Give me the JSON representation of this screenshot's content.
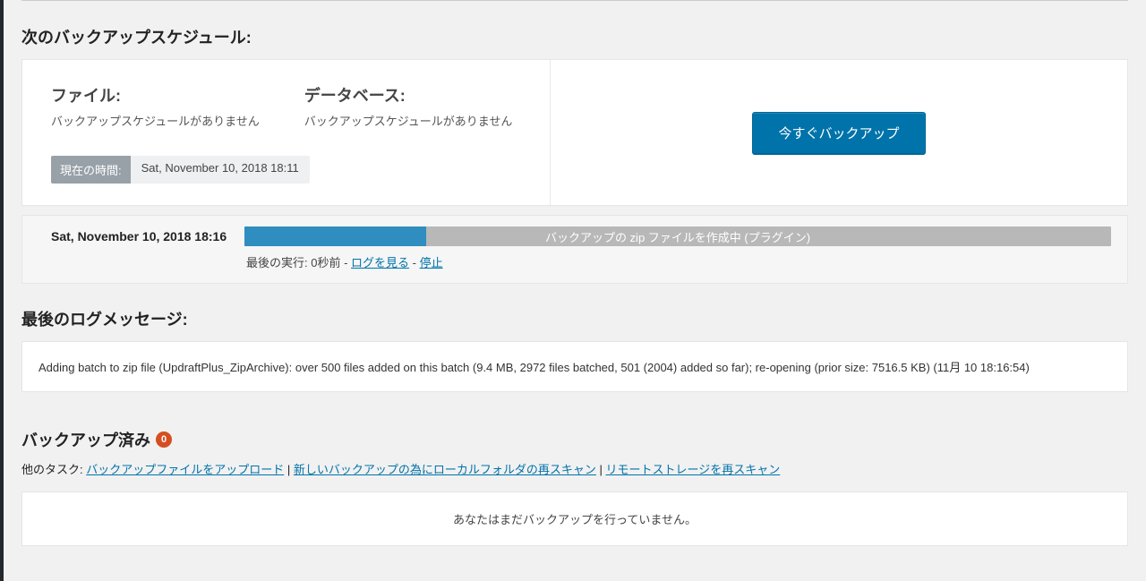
{
  "sections": {
    "schedule": {
      "title": "次のバックアップスケジュール:",
      "files": {
        "heading": "ファイル:",
        "status": "バックアップスケジュールがありません"
      },
      "database": {
        "heading": "データベース:",
        "status": "バックアップスケジュールがありません"
      },
      "current_time": {
        "label": "現在の時間:",
        "value": "Sat, November 10, 2018 18:11"
      },
      "backup_now_button": "今すぐバックアップ"
    },
    "progress": {
      "timestamp": "Sat, November 10, 2018 18:16",
      "bar": {
        "label": "バックアップの zip ファイルを作成中 (プラグイン)",
        "percent": 21
      },
      "substatus": {
        "prefix": "最後の実行: 0秒前 - ",
        "link_view_log": "ログを見る",
        "sep": " - ",
        "link_stop": "停止"
      }
    },
    "last_log": {
      "title": "最後のログメッセージ:",
      "message": "Adding batch to zip file (UpdraftPlus_ZipArchive): over 500 files added on this batch (9.4 MB, 2972 files batched, 501 (2004) added so far); re-opening (prior size: 7516.5 KB) (11月 10 18:16:54)"
    },
    "backups": {
      "title": "バックアップ済み",
      "count": "0",
      "other_tasks": {
        "label": "他のタスク: ",
        "link_upload": "バックアップファイルをアップロード",
        "link_rescan_local": "新しいバックアップの為にローカルフォルダの再スキャン",
        "link_rescan_remote": "リモートストレージを再スキャン"
      },
      "empty": "あなたはまだバックアップを行っていません。"
    }
  }
}
